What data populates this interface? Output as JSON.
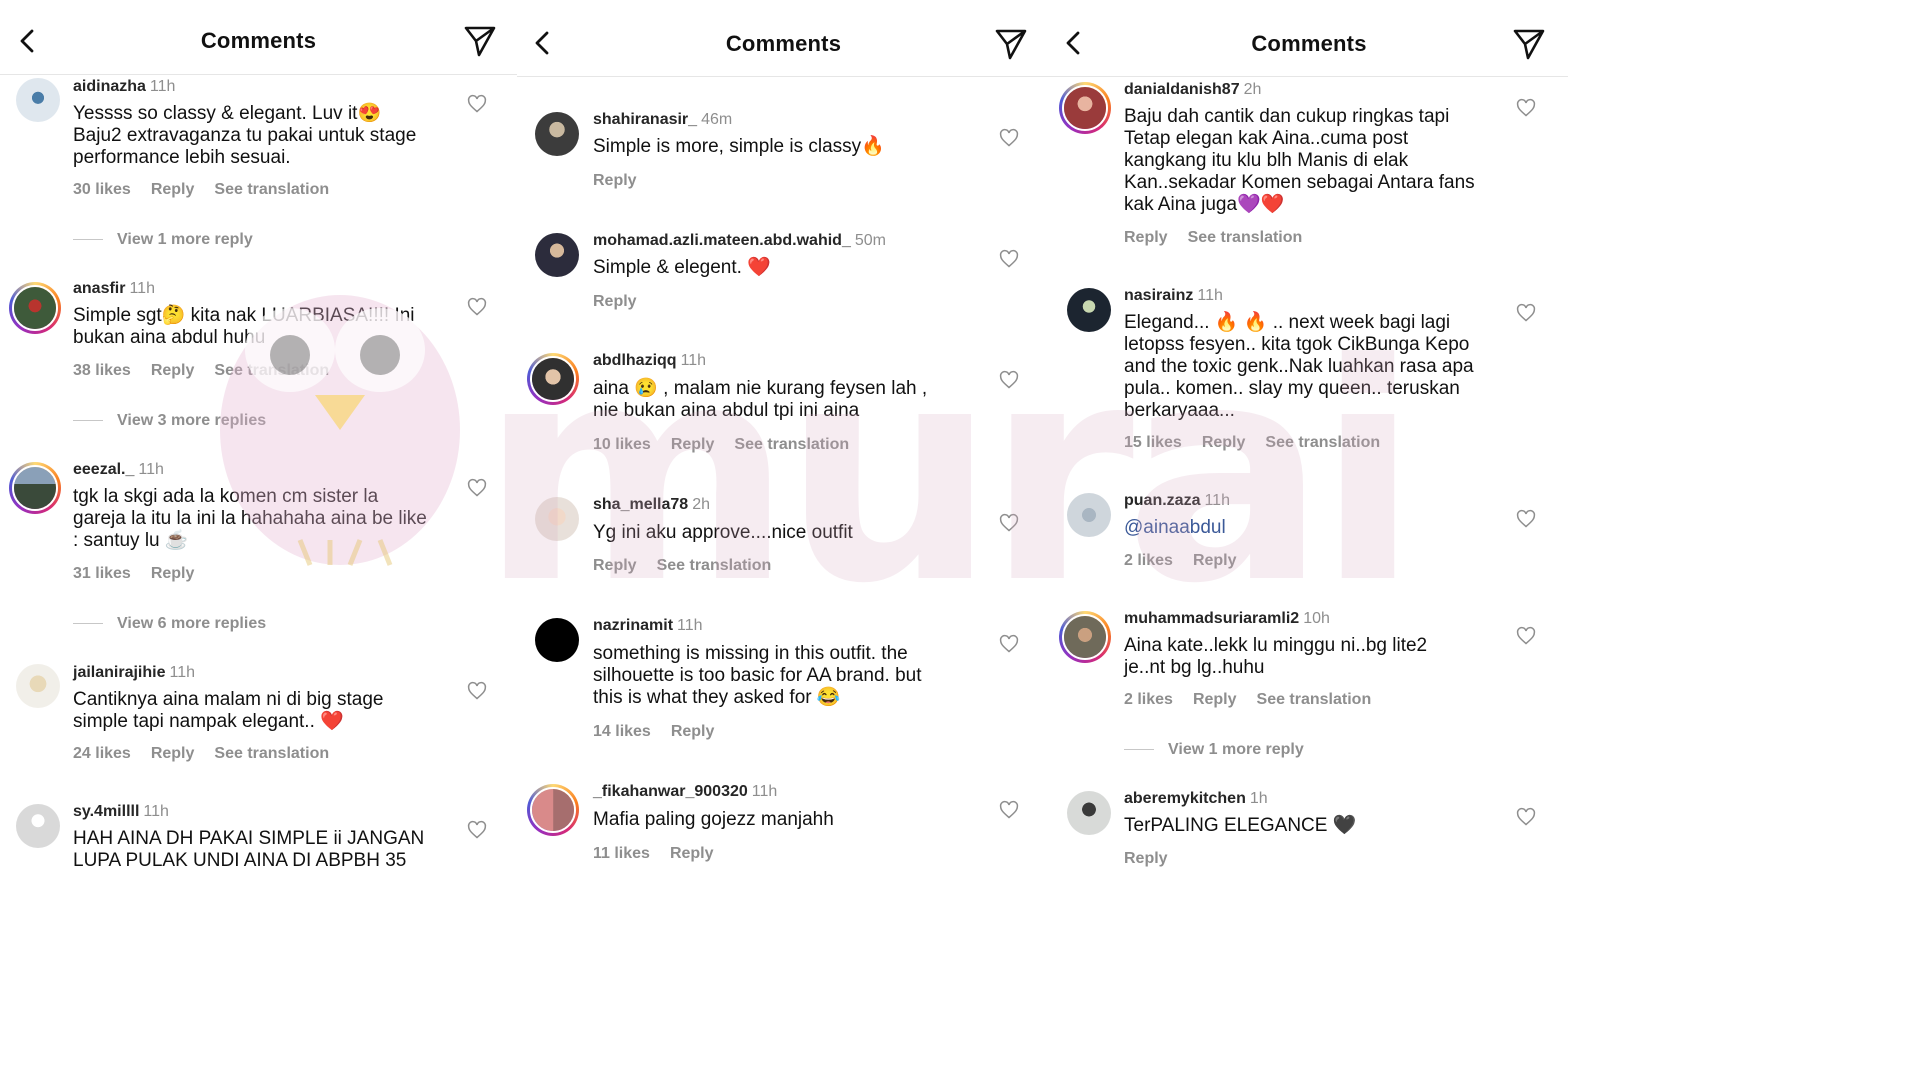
{
  "title": "Comments",
  "panels": [
    {
      "comments": [
        {
          "user": "aidinazha",
          "time": "11h",
          "text": "Yessss so classy & elegant. Luv it😍\nBaju2 extravaganza tu pakai untuk stage\nperformance lebih sesuai.",
          "likes": "30 likes",
          "reply": "Reply",
          "translate": "See translation",
          "view_more": "View 1 more reply"
        },
        {
          "user": "anasfir",
          "time": "11h",
          "text": "Simple sgt🤔 kita nak LUARBIASA!!!! Ini\nbukan aina abdul huhu",
          "likes": "38 likes",
          "reply": "Reply",
          "translate": "See translation",
          "view_more": "View 3 more replies"
        },
        {
          "user": "eeezal._",
          "time": "11h",
          "text": "tgk la skgi ada la komen cm sister la\ngareja la itu la ini la hahahaha aina be like\n: santuy lu ☕",
          "likes": "31 likes",
          "reply": "Reply",
          "view_more": "View 6 more replies"
        },
        {
          "user": "jailanirajihie",
          "time": "11h",
          "text": "Cantiknya aina malam ni di big stage\nsimple tapi nampak elegant.. ❤️",
          "likes": "24 likes",
          "reply": "Reply",
          "translate": "See translation"
        },
        {
          "user": "sy.4millll",
          "time": "11h",
          "text": "HAH AINA DH PAKAI SIMPLE ii JANGAN\nLUPA PULAK UNDI AINA DI ABPBH 35"
        }
      ]
    },
    {
      "comments": [
        {
          "user": "shahiranasir_",
          "time": "46m",
          "text": "Simple is more, simple is classy🔥",
          "reply": "Reply"
        },
        {
          "user": "mohamad.azli.mateen.abd.wahid_",
          "time": "50m",
          "text": "Simple & elegent. ❤️",
          "reply": "Reply"
        },
        {
          "user": "abdlhaziqq",
          "time": "11h",
          "text": "aina 😢 , malam nie kurang feysen lah ,\nnie bukan aina abdul tpi ini aina",
          "likes": "10 likes",
          "reply": "Reply",
          "translate": "See translation"
        },
        {
          "user": "sha_mella78",
          "time": "2h",
          "text": "Yg ini aku approve....nice outfit",
          "reply": "Reply",
          "translate": "See translation"
        },
        {
          "user": "nazrinamit",
          "time": "11h",
          "text": "something is missing in this outfit. the\nsilhouette is too basic for AA brand. but\nthis is what they asked for 😂",
          "likes": "14 likes",
          "reply": "Reply"
        },
        {
          "user": "_fikahanwar_900320",
          "time": "11h",
          "text": "Mafia paling gojezz manjahh",
          "likes": "11 likes",
          "reply": "Reply"
        }
      ]
    },
    {
      "comments": [
        {
          "user": "danialdanish87",
          "time": "2h",
          "text": "Baju dah cantik dan cukup ringkas tapi\nTetap elegan kak Aina..cuma post\nkangkang itu klu blh Manis di elak\nKan..sekadar Komen sebagai Antara fans\nkak Aina juga💜❤️",
          "reply": "Reply",
          "translate": "See translation"
        },
        {
          "user": "nasirainz",
          "time": "11h",
          "text": "Elegand... 🔥 🔥 .. next week bagi lagi\nletopss fesyen.. kita tgok CikBunga Kepo\nand the toxic genk..Nak luahkan rasa apa\npula.. komen.. slay my queen.. teruskan\nberkaryaaa...",
          "likes": "15 likes",
          "reply": "Reply",
          "translate": "See translation"
        },
        {
          "user": "puan.zaza",
          "time": "11h",
          "text": "@ainaabdul",
          "likes": "2 likes",
          "reply": "Reply"
        },
        {
          "user": "muhammadsuriaramli2",
          "time": "10h",
          "text": "Aina kate..lekk lu minggu ni..bg lite2\nje..nt bg lg..huhu",
          "likes": "2 likes",
          "reply": "Reply",
          "translate": "See translation",
          "view_more": "View 1 more reply"
        },
        {
          "user": "aberemykitchen",
          "time": "1h",
          "text": "TerPALING ELEGANCE 🖤",
          "reply": "Reply"
        }
      ]
    }
  ],
  "colors": {
    "meta": "#8e8e8e",
    "link": "#3b5998",
    "heart": "#8e8e8e"
  },
  "icons": {
    "back": "chevron-left-icon",
    "send": "send-icon",
    "like": "heart-icon"
  }
}
